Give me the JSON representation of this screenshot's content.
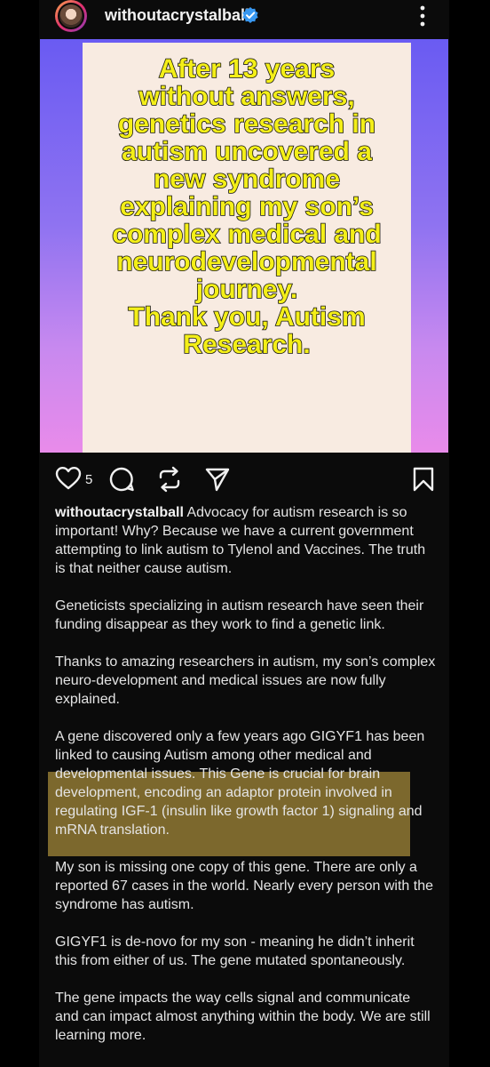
{
  "header": {
    "username": "withoutacrystalball",
    "avatar_icon": "profile-photo",
    "verified_icon": "verified-badge-icon",
    "more_icon": "more-vertical-icon"
  },
  "post_image": {
    "text": "After 13 years\nwithout answers,\ngenetics research in\nautism uncovered a\nnew syndrome\nexplaining my son’s\ncomplex medical and\nneurodevelopmental\njourney.\nThank you, Autism\nResearch.",
    "text_color": "#f4ef18",
    "panel_color": "#f8ebe1"
  },
  "actions": {
    "like_count": "5",
    "icons": [
      "heart-icon",
      "comment-icon",
      "repost-icon",
      "share-icon",
      "bookmark-icon"
    ]
  },
  "caption": {
    "username": "withoutacrystalball",
    "paragraph_1": " Advocacy for autism research is so important! Why? Because we have a current government attempting to link autism to Tylenol and Vaccines. The truth is that neither cause autism.",
    "paragraph_2": "Geneticists specializing in autism research have seen their funding disappear as they work to find a genetic link.",
    "paragraph_3": "Thanks to amazing researchers in autism, my son’s complex neuro-development and medical issues are now fully explained.",
    "paragraph_4": "A gene discovered only a few years ago GIGYF1 has been linked to causing Autism among other medical and developmental issues. This Gene is crucial for brain development, encoding an adaptor protein involved in regulating IGF-1 (insulin like growth factor 1) signaling and mRNA translation.",
    "paragraph_5": "My son is missing one copy of this gene. There are only a reported 67 cases in the world. Nearly every person with the syndrome has autism.",
    "paragraph_6": "GIGYF1 is de-novo for my son - meaning he didn’t inherit this from either of us. The gene mutated spontaneously.",
    "paragraph_7": "The gene impacts the way cells signal and communicate and can impact almost anything within the body. We are still learning more.",
    "highlight_color": "#a88c3a"
  }
}
